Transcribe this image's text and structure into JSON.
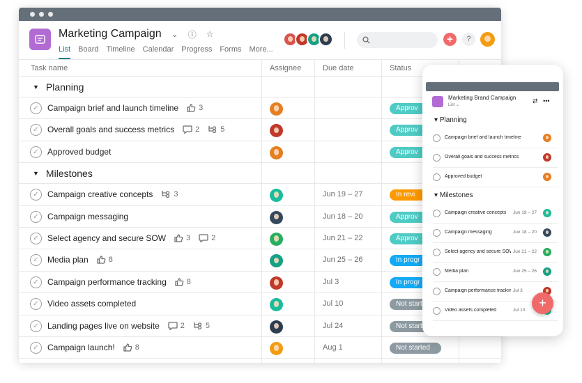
{
  "project": {
    "title": "Marketing Campaign",
    "icon": "list-icon",
    "tabs": [
      "List",
      "Board",
      "Timeline",
      "Calendar",
      "Progress",
      "Forms",
      "More..."
    ],
    "active_tab": "List"
  },
  "header_avatars": [
    "#d9534f",
    "#c0392b",
    "#16a085",
    "#2c3e50"
  ],
  "me_avatar": "#f39c12",
  "columns": {
    "task": "Task name",
    "assignee": "Assignee",
    "due": "Due date",
    "status": "Status"
  },
  "colors": {
    "approved": "#4ecbc4",
    "in_review": "#fd9a00",
    "in_progress": "#14aaf5",
    "not_started": "#8d9aa1",
    "accent": "#f06a6a",
    "purple": "#b36bd4",
    "tab_active": "#0d7f8c"
  },
  "sections": [
    {
      "name": "Planning",
      "tasks": [
        {
          "name": "Campaign brief and launch timeline",
          "likes": "3",
          "comments": "",
          "subtasks": "",
          "avatar": "#e67e22",
          "due": "",
          "status": "Approv",
          "status_key": "approved"
        },
        {
          "name": "Overall goals and success metrics",
          "likes": "",
          "comments": "2",
          "subtasks": "5",
          "avatar": "#c0392b",
          "due": "",
          "status": "Approv",
          "status_key": "approved"
        },
        {
          "name": "Approved budget",
          "likes": "",
          "comments": "",
          "subtasks": "",
          "avatar": "#e67e22",
          "due": "",
          "status": "Approv",
          "status_key": "approved"
        }
      ]
    },
    {
      "name": "Milestones",
      "tasks": [
        {
          "name": "Campaign creative concepts",
          "likes": "",
          "comments": "",
          "subtasks": "3",
          "avatar": "#1abc9c",
          "due": "Jun 19 – 27",
          "status": "In revi",
          "status_key": "in_review"
        },
        {
          "name": "Campaign messaging",
          "likes": "",
          "comments": "",
          "subtasks": "",
          "avatar": "#34495e",
          "due": "Jun 18 – 20",
          "status": "Approv",
          "status_key": "approved"
        },
        {
          "name": "Select agency and secure SOW",
          "likes": "3",
          "comments": "2",
          "subtasks": "",
          "avatar": "#27ae60",
          "due": "Jun 21 – 22",
          "status": "Approv",
          "status_key": "approved"
        },
        {
          "name": "Media plan",
          "likes": "8",
          "comments": "",
          "subtasks": "",
          "avatar": "#16a085",
          "due": "Jun 25 – 26",
          "status": "In progr",
          "status_key": "in_progress"
        },
        {
          "name": "Campaign performance tracking",
          "likes": "8",
          "comments": "",
          "subtasks": "",
          "avatar": "#c0392b",
          "due": "Jul 3",
          "status": "In progr",
          "status_key": "in_progress"
        },
        {
          "name": "Video assets completed",
          "likes": "",
          "comments": "",
          "subtasks": "",
          "avatar": "#1abc9c",
          "due": "Jul 10",
          "status": "Not start",
          "status_key": "not_started"
        },
        {
          "name": "Landing pages live on website",
          "likes": "",
          "comments": "2",
          "subtasks": "5",
          "avatar": "#2c3e50",
          "due": "Jul 24",
          "status": "Not start",
          "status_key": "not_started"
        },
        {
          "name": "Campaign launch!",
          "likes": "8",
          "comments": "",
          "subtasks": "",
          "avatar": "#f39c12",
          "due": "Aug 1",
          "status": "Not started",
          "status_key": "not_started"
        }
      ]
    }
  ],
  "phone": {
    "title": "Marketing Brand Campaign",
    "view": "List",
    "sections": [
      {
        "name": "Planning",
        "tasks": [
          {
            "name": "Campaign brief and launch timeline",
            "due": "",
            "avatar": "#e67e22"
          },
          {
            "name": "Overall goals and success metrics",
            "due": "",
            "avatar": "#c0392b"
          },
          {
            "name": "Approved budget",
            "due": "",
            "avatar": "#e67e22"
          }
        ]
      },
      {
        "name": "Milestones",
        "tasks": [
          {
            "name": "Campaign creative concepts",
            "due": "Jun 19 – 27",
            "avatar": "#1abc9c"
          },
          {
            "name": "Campaign messaging",
            "due": "Jun 18 – 20",
            "avatar": "#34495e"
          },
          {
            "name": "Select agency and secure SOW",
            "due": "Jun 21 – 22",
            "avatar": "#27ae60"
          },
          {
            "name": "Media plan",
            "due": "Jun 25 – 26",
            "avatar": "#16a085"
          },
          {
            "name": "Campaign performance tracking",
            "due": "Jul 3",
            "avatar": "#c0392b"
          },
          {
            "name": "Video assets completed",
            "due": "Jul 10",
            "avatar": "#1abc9c"
          }
        ]
      }
    ]
  }
}
